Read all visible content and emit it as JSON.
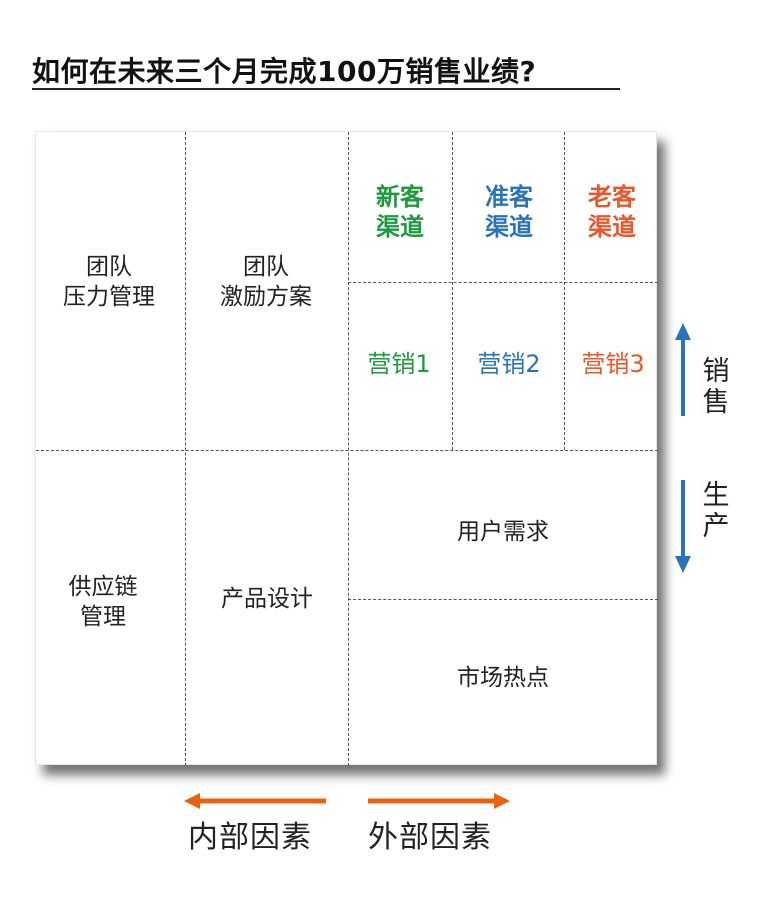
{
  "title": "如何在未来三个月完成100万销售业绩?",
  "left_col": {
    "team_pressure": [
      "团队",
      "压力管理"
    ],
    "supply_chain": [
      "供应链",
      "管理"
    ]
  },
  "mid_col": {
    "team_incentive": [
      "团队",
      "激励方案"
    ],
    "product_design": "产品设计"
  },
  "channels": [
    {
      "lines": [
        "新客",
        "渠道"
      ],
      "color": "#1e9a3e"
    },
    {
      "lines": [
        "准客",
        "渠道"
      ],
      "color": "#2b73b8"
    },
    {
      "lines": [
        "老客",
        "渠道"
      ],
      "color": "#e8562a"
    }
  ],
  "marketing": [
    {
      "label": "营销1",
      "color": "#1e9a3e"
    },
    {
      "label": "营销2",
      "color": "#2b73b8"
    },
    {
      "label": "营销3",
      "color": "#e8562a"
    }
  ],
  "production": {
    "user_demand": "用户需求",
    "market_hotspot": "市场热点"
  },
  "side": {
    "sales": [
      "销",
      "售"
    ],
    "production": [
      "生",
      "产"
    ]
  },
  "bottom": {
    "internal": "内部因素",
    "external": "外部因素"
  },
  "colors": {
    "arrow_blue": "#2b73b8",
    "arrow_orange": "#e8630f"
  }
}
